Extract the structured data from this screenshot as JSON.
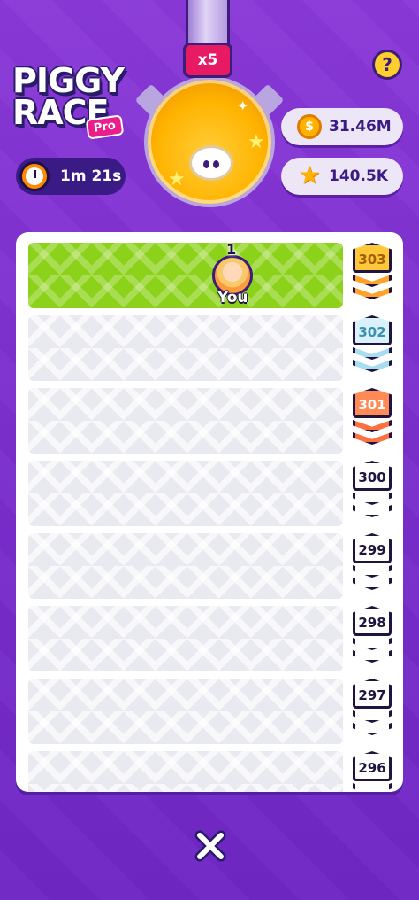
{
  "logo": {
    "line1": "PIGGY",
    "line2": "RACE",
    "badge": "Pro"
  },
  "help": {
    "label": "?"
  },
  "timer": {
    "icon": "stopwatch-icon",
    "text": "1m 21s"
  },
  "multiplier": "x5",
  "currencies": {
    "coins": {
      "icon": "coin-icon",
      "glyph": "$",
      "value": "31.46M"
    },
    "stars": {
      "icon": "star-icon",
      "glyph": "★",
      "value": "140.5K"
    }
  },
  "race": {
    "player": {
      "rank": "1",
      "label": "You"
    },
    "levels": [
      {
        "value": "303",
        "tier": "gold"
      },
      {
        "value": "302",
        "tier": "silver"
      },
      {
        "value": "301",
        "tier": "bronze"
      },
      {
        "value": "300",
        "tier": "plain"
      },
      {
        "value": "299",
        "tier": "plain"
      },
      {
        "value": "298",
        "tier": "plain"
      },
      {
        "value": "297",
        "tier": "plain"
      },
      {
        "value": "296",
        "tier": "plain"
      }
    ]
  },
  "close": {
    "icon": "close-icon"
  },
  "colors": {
    "accent": "#8cd11a",
    "background": "#7d30cf",
    "gold": "#ffc83a"
  }
}
